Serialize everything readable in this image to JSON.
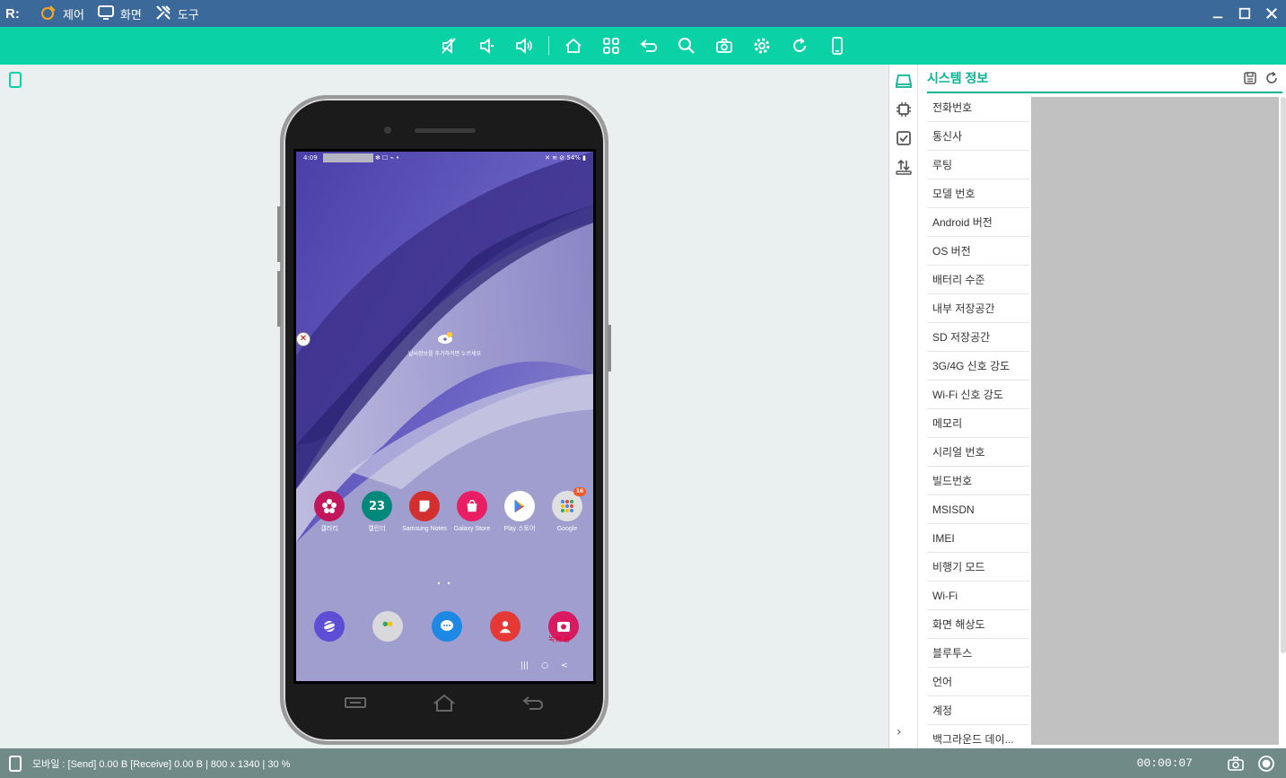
{
  "titlebar": {
    "logo": "R:",
    "menu": [
      {
        "label": "제어",
        "icon": "control-icon"
      },
      {
        "label": "화면",
        "icon": "screen-icon"
      },
      {
        "label": "도구",
        "icon": "tools-icon"
      }
    ]
  },
  "toolbar": {
    "buttons": [
      "mute-icon",
      "volume-down-icon",
      "volume-up-icon",
      "home-icon",
      "apps-icon",
      "back-icon",
      "search-icon",
      "camera-icon",
      "settings-icon",
      "refresh-icon",
      "device-icon"
    ]
  },
  "phone": {
    "status_time": "4:09",
    "status_right": "54%",
    "weather_text": "날씨정보를 추가하려면 누르세요",
    "apps": [
      {
        "label": "갤러리",
        "color": "#c2185b"
      },
      {
        "label": "캘린더",
        "color": "#00897b",
        "text": "23"
      },
      {
        "label": "Samsung Notes",
        "color": "#d32f2f"
      },
      {
        "label": "Galaxy Store",
        "color": "#e91e63"
      },
      {
        "label": "Play 스토어",
        "color": "#ffffff"
      },
      {
        "label": "Google",
        "color": "#e0e0e0",
        "badge": "16"
      }
    ],
    "dock": [
      {
        "icon": "internet-icon",
        "color": "#5c4fd6"
      },
      {
        "icon": "folder-icon",
        "color": "#d9d9dd"
      },
      {
        "icon": "messages-icon",
        "color": "#1e88e5"
      },
      {
        "icon": "contacts-icon",
        "color": "#e53935"
      },
      {
        "icon": "camera-app-icon",
        "color": "#d81b60"
      }
    ],
    "recording_text": "녹화 중"
  },
  "panel": {
    "title": "시스템 정보",
    "items": [
      "전화번호",
      "통신사",
      "루팅",
      "모델 번호",
      "Android 버전",
      "OS 버전",
      "배터리 수준",
      "내부 저장공간",
      "SD 저장공간",
      "3G/4G 신호 강도",
      "Wi-Fi 신호 강도",
      "메모리",
      "시리얼 번호",
      "빌드번호",
      "MSISDN",
      "IMEI",
      "비행기 모드",
      "Wi-Fi",
      "화면 해상도",
      "블루투스",
      "언어",
      "계정",
      "백그라운드 데이..."
    ]
  },
  "status": {
    "text": "모바일 : [Send] 0.00 B  [Receive] 0.00 B | 800 x 1340 | 30 %",
    "timer": "00:00:07"
  },
  "colors": {
    "titlebar": "#3b6a9a",
    "toolbar": "#0ad1a6",
    "accent": "#0ab494",
    "statusbar": "#6f8a87"
  }
}
